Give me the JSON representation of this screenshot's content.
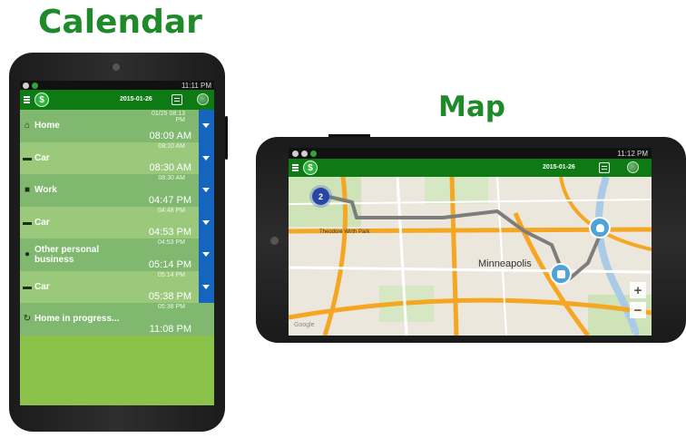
{
  "headings": {
    "calendar": "Calendar",
    "map": "Map"
  },
  "calendar_phone": {
    "statusbar": {
      "time": "11:11 PM"
    },
    "appbar": {
      "date": "2015-01-26",
      "logo": "$"
    },
    "entries": [
      {
        "label": "Home",
        "time_small": "01/25 08:13 PM",
        "time_main": "08:09 AM",
        "icon": "home-icon",
        "has_tab": true
      },
      {
        "label": "Car",
        "time_small": "08:10 AM",
        "time_main": "08:30 AM",
        "icon": "car-icon",
        "has_tab": true
      },
      {
        "label": "Work",
        "time_small": "08:30 AM",
        "time_main": "04:47 PM",
        "icon": "briefcase-icon",
        "has_tab": true
      },
      {
        "label": "Car",
        "time_small": "04:48 PM",
        "time_main": "04:53 PM",
        "icon": "car-icon",
        "has_tab": true
      },
      {
        "label": "Other personal business",
        "time_small": "04:53 PM",
        "time_main": "05:14 PM",
        "icon": "person-icon",
        "has_tab": true
      },
      {
        "label": "Car",
        "time_small": "05:14 PM",
        "time_main": "05:38 PM",
        "icon": "car-icon",
        "has_tab": true
      },
      {
        "label": "Home in progress...",
        "time_small": "05:38 PM",
        "time_main": "11:08 PM",
        "icon": "sync-icon",
        "has_tab": false
      }
    ]
  },
  "map_phone": {
    "statusbar": {
      "time": "11:12 PM"
    },
    "appbar": {
      "date": "2015-01-26",
      "logo": "$"
    },
    "map": {
      "city_label": "Minneapolis",
      "park_label": "Theodore Wirth Park",
      "cluster_count": "2",
      "attribution": "Google",
      "zoom_in": "+",
      "zoom_out": "−"
    }
  },
  "colors": {
    "heading": "#1f8a2a",
    "appbar": "#0d7a14",
    "row_dark": "#7fb86e",
    "row_light": "#9bc97c",
    "tab_blue": "#1565c0",
    "route": "#8a8a8a"
  }
}
